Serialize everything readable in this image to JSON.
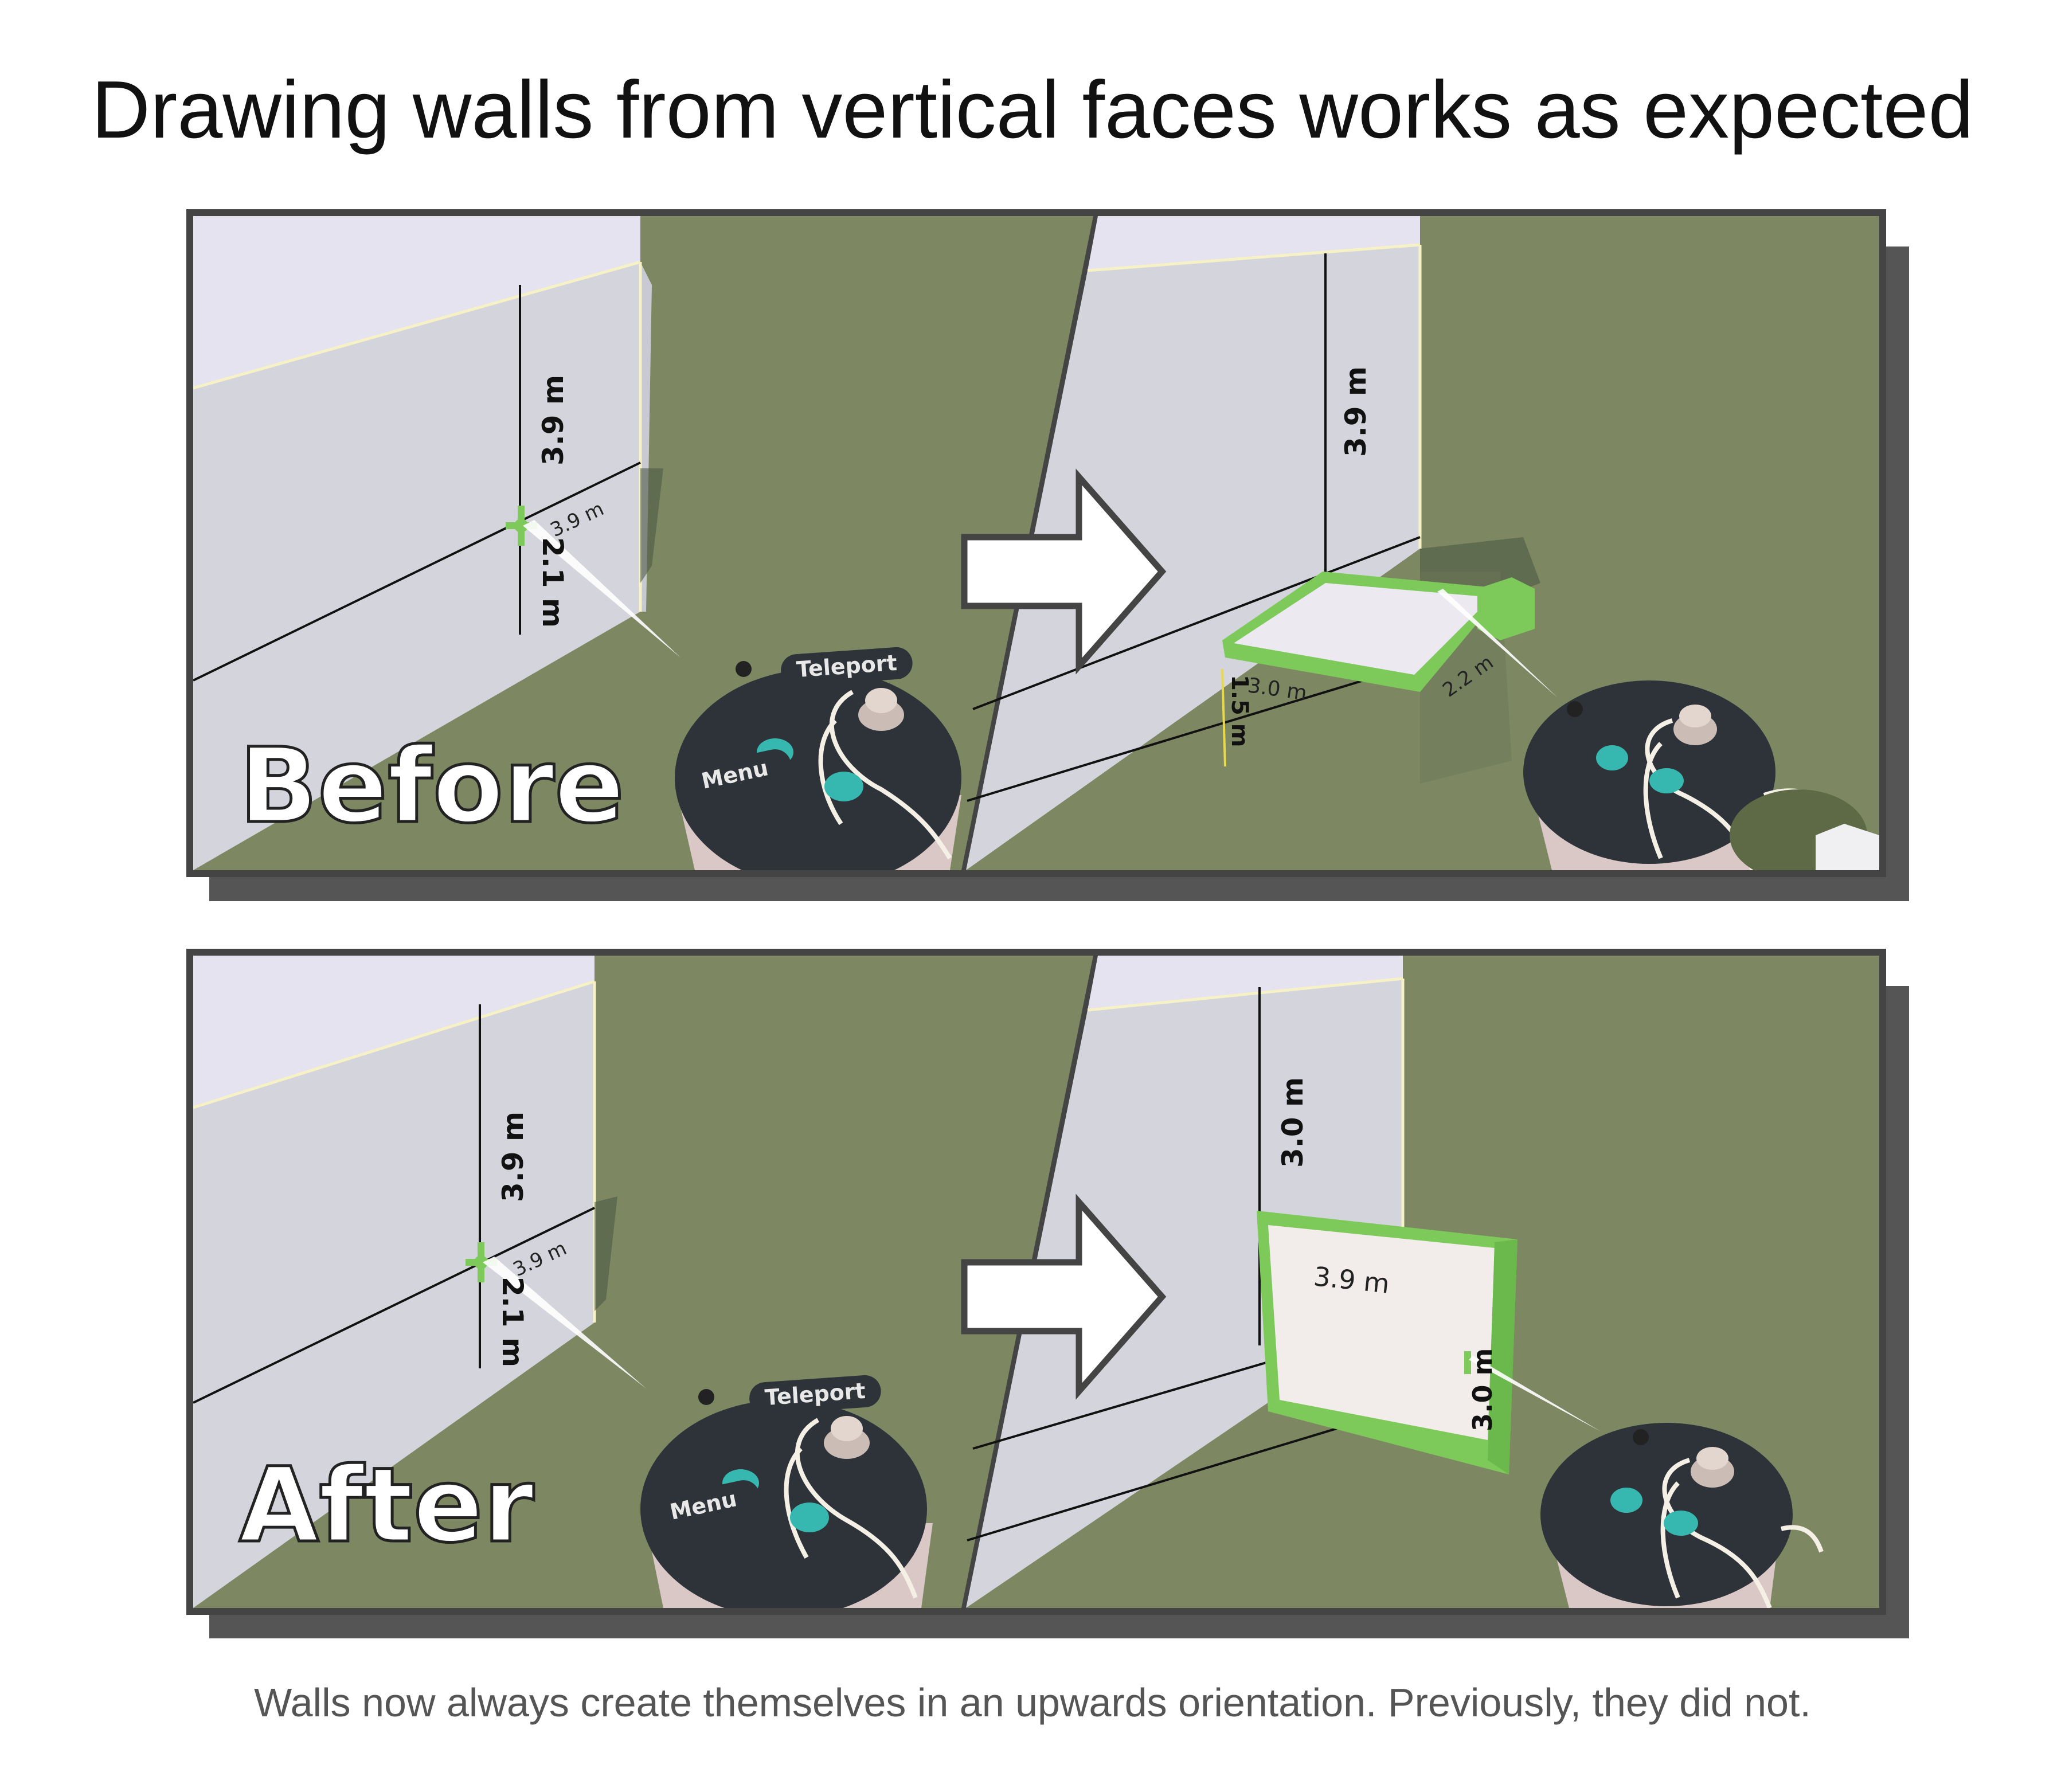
{
  "title": "Drawing walls from vertical faces works as expected",
  "caption": "Walls now always create themselves in an upwards orientation. Previously, they did not.",
  "colors": {
    "background": "#ffffff",
    "panel_border": "#444444",
    "panel_shadow": "#555555",
    "ground": "#7d8863",
    "wall_face": "#d4d5dc",
    "wall_top": "#e4e3ef",
    "highlight_green": "#7dc95a",
    "controller_dark": "#2d3338",
    "controller_button": "#36b8b0",
    "arrow_fill": "#ffffff",
    "arrow_stroke": "#444444"
  },
  "panels": {
    "before": {
      "label": "Before",
      "left": {
        "vertical_measure": "3.9 m",
        "pointer_measure": "3.9 m",
        "lower_measure": "2.1 m",
        "controller": {
          "top_button": "Teleport",
          "side_button": "Menu"
        }
      },
      "right": {
        "vertical_measure": "3.9 m",
        "wall_measure_a": "3.0 m",
        "wall_measure_b": "2.2 m",
        "wall_measure_c": "1.5 m"
      }
    },
    "after": {
      "label": "After",
      "left": {
        "vertical_measure": "3.9 m",
        "pointer_measure": "3.9 m",
        "lower_measure": "2.1 m",
        "controller": {
          "top_button": "Teleport",
          "side_button": "Menu"
        }
      },
      "right": {
        "vertical_measure": "3.0 m",
        "wall_measure_a": "3.9 m",
        "wall_measure_b": "3.0 m"
      }
    }
  }
}
